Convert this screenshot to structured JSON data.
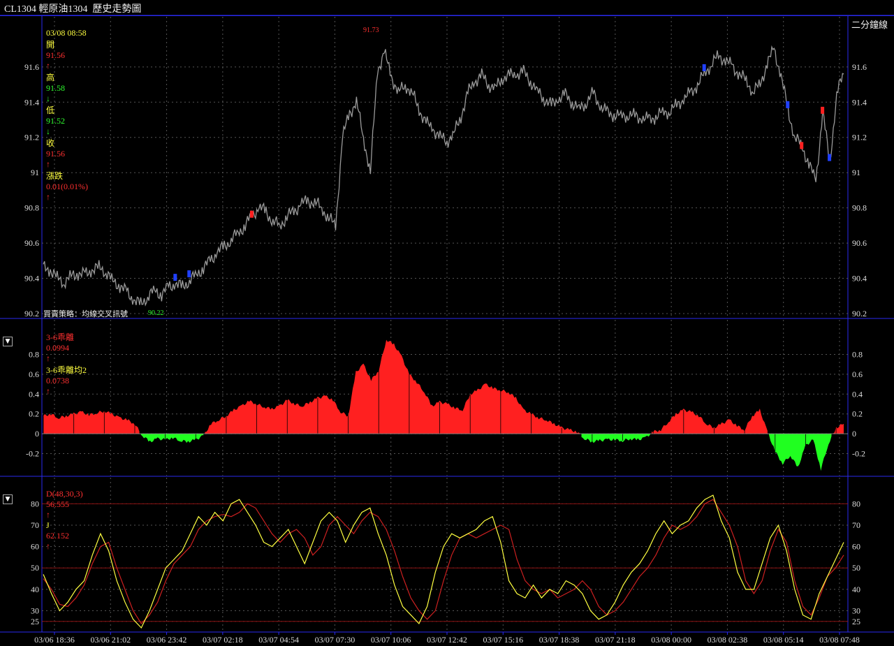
{
  "window": {
    "title": "CL1304 輕原油1304  歷史走勢圖"
  },
  "price_panel": {
    "date": "03/08 08:58",
    "open_label": "開",
    "open": "91.56",
    "high_label": "高",
    "high": "91.58",
    "low_label": "低",
    "low": "91.52",
    "close_label": "收",
    "close": "91.56",
    "change_label": "漲跌",
    "change": "0.01(0.01%)",
    "period": "二分鐘線",
    "strategy": "買賣策略：均線交叉訊號",
    "max_label": "91.73",
    "min_label": "90.22",
    "up_arrow": "↑",
    "down_arrow": "↓"
  },
  "bias_panel": {
    "name1": "3-6乖離",
    "value1": "0.0994",
    "name2": "3-6乖離均2",
    "value2": "0.0738",
    "collapse": "▼"
  },
  "kdj_panel": {
    "name1": "D(48,30,3)",
    "value1": "56.555",
    "name2": "J",
    "value2": "62.152",
    "collapse": "▼"
  },
  "colors": {
    "up": "#ff2020",
    "down": "#20ff20",
    "price": "#9a9a9a",
    "axis": "#2a2af0",
    "grid": "#555555",
    "yellow": "#ffff40",
    "kline": "#cc2020"
  },
  "chart_data": [
    {
      "type": "line",
      "title": "CL1304 輕原油1304 歷史走勢圖",
      "ylim": [
        90.2,
        91.75
      ],
      "yticks": [
        "91.6",
        "91.4",
        "91.2",
        "91",
        "90.8",
        "90.6",
        "90.4",
        "90.2"
      ],
      "x_ticks": [
        "03/06 18:36",
        "03/06 21:02",
        "03/06 23:42",
        "03/07 02:18",
        "03/07 04:54",
        "03/07 07:30",
        "03/07 10:06",
        "03/07 12:42",
        "03/07 15:16",
        "03/07 18:38",
        "03/07 21:18",
        "03/08 00:00",
        "03/08 02:38",
        "03/08 05:14",
        "03/08 07:48"
      ],
      "series": [
        {
          "name": "",
          "values": [
            90.46,
            90.45,
            90.4,
            90.38,
            90.41,
            90.43,
            90.42,
            90.45,
            90.46,
            90.44,
            90.38,
            90.36,
            90.32,
            90.28,
            90.25,
            90.3,
            90.33,
            90.31,
            90.35,
            90.37,
            90.35,
            90.39,
            90.42,
            90.46,
            90.5,
            90.55,
            90.58,
            90.62,
            90.66,
            90.7,
            90.76,
            90.8,
            90.78,
            90.72,
            90.7,
            90.75,
            90.78,
            90.82,
            90.84,
            90.83,
            90.8,
            90.74,
            90.7,
            91.2,
            91.34,
            91.4,
            91.2,
            91.0,
            91.58,
            91.68,
            91.55,
            91.45,
            91.5,
            91.45,
            91.36,
            91.28,
            91.25,
            91.2,
            91.18,
            91.22,
            91.32,
            91.45,
            91.52,
            91.55,
            91.5,
            91.48,
            91.54,
            91.55,
            91.56,
            91.57,
            91.52,
            91.46,
            91.42,
            91.38,
            91.42,
            91.44,
            91.4,
            91.36,
            91.4,
            91.45,
            91.38,
            91.34,
            91.33,
            91.32,
            91.33,
            91.32,
            91.31,
            91.3,
            91.32,
            91.34,
            91.35,
            91.38,
            91.42,
            91.45,
            91.5,
            91.56,
            91.62,
            91.66,
            91.64,
            91.6,
            91.56,
            91.52,
            91.46,
            91.5,
            91.62,
            91.7,
            91.55,
            91.35,
            91.2,
            91.15,
            91.05,
            90.95,
            91.35,
            91.05,
            91.45,
            91.56
          ]
        }
      ]
    },
    {
      "type": "area",
      "title": "3-6乖離",
      "ylim": [
        -0.38,
        0.98
      ],
      "yticks": [
        "0.8",
        "0.6",
        "0.4",
        "0.2",
        "0",
        "-0.2"
      ],
      "series": [
        {
          "name": "3-6乖離",
          "values": [
            0.18,
            0.2,
            0.16,
            0.18,
            0.2,
            0.22,
            0.19,
            0.21,
            0.23,
            0.2,
            0.16,
            0.14,
            0.1,
            -0.02,
            -0.08,
            -0.05,
            -0.06,
            -0.04,
            -0.07,
            -0.08,
            -0.06,
            -0.02,
            0.1,
            0.14,
            0.18,
            0.24,
            0.28,
            0.33,
            0.3,
            0.27,
            0.25,
            0.28,
            0.34,
            0.3,
            0.28,
            0.32,
            0.36,
            0.38,
            0.34,
            0.22,
            0.18,
            0.62,
            0.7,
            0.54,
            0.64,
            0.95,
            0.9,
            0.78,
            0.6,
            0.52,
            0.42,
            0.28,
            0.32,
            0.3,
            0.26,
            0.24,
            0.4,
            0.44,
            0.5,
            0.46,
            0.44,
            0.42,
            0.36,
            0.24,
            0.2,
            0.16,
            0.14,
            0.1,
            0.06,
            0.04,
            0.02,
            -0.05,
            -0.08,
            -0.07,
            -0.06,
            -0.06,
            -0.07,
            -0.05,
            -0.06,
            -0.04,
            0.02,
            0.04,
            0.12,
            0.2,
            0.24,
            0.22,
            0.18,
            0.1,
            0.06,
            0.1,
            0.14,
            0.08,
            0.04,
            0.18,
            0.24,
            0.02,
            -0.18,
            -0.3,
            -0.22,
            -0.34,
            -0.12,
            -0.06,
            -0.36,
            -0.1,
            0.06,
            0.1
          ]
        }
      ]
    },
    {
      "type": "line",
      "title": "D(48,30,3)",
      "ylim": [
        22,
        85
      ],
      "yticks": [
        "80",
        "70",
        "60",
        "50",
        "40",
        "30",
        "25"
      ],
      "refs": [
        80,
        50,
        25
      ],
      "series": [
        {
          "name": "D(48,30,3)",
          "values": [
            45,
            40,
            33,
            32,
            36,
            42,
            52,
            60,
            62,
            50,
            40,
            30,
            24,
            28,
            34,
            44,
            52,
            56,
            60,
            68,
            72,
            74,
            75,
            74,
            76,
            80,
            78,
            72,
            66,
            62,
            66,
            68,
            64,
            56,
            60,
            70,
            74,
            70,
            66,
            72,
            76,
            74,
            68,
            58,
            46,
            36,
            30,
            26,
            30,
            44,
            56,
            64,
            66,
            64,
            66,
            68,
            70,
            68,
            54,
            44,
            40,
            38,
            40,
            36,
            38,
            40,
            44,
            40,
            32,
            28,
            30,
            34,
            40,
            46,
            50,
            56,
            64,
            70,
            68,
            70,
            74,
            80,
            82,
            76,
            70,
            60,
            44,
            38,
            44,
            58,
            68,
            62,
            44,
            32,
            28,
            36,
            46,
            50,
            56
          ]
        },
        {
          "name": "J",
          "values": [
            47,
            38,
            30,
            34,
            40,
            44,
            56,
            66,
            58,
            44,
            34,
            26,
            22,
            30,
            40,
            50,
            54,
            58,
            66,
            74,
            70,
            76,
            72,
            80,
            82,
            76,
            70,
            62,
            60,
            64,
            68,
            60,
            52,
            62,
            72,
            76,
            72,
            62,
            70,
            76,
            78,
            66,
            56,
            42,
            32,
            28,
            24,
            32,
            48,
            60,
            66,
            64,
            66,
            68,
            72,
            74,
            62,
            44,
            38,
            36,
            42,
            36,
            40,
            38,
            44,
            42,
            38,
            30,
            26,
            28,
            34,
            42,
            48,
            52,
            58,
            66,
            72,
            66,
            70,
            72,
            78,
            82,
            84,
            72,
            64,
            48,
            40,
            40,
            52,
            64,
            70,
            58,
            40,
            28,
            26,
            38,
            46,
            54,
            62
          ]
        }
      ]
    }
  ]
}
